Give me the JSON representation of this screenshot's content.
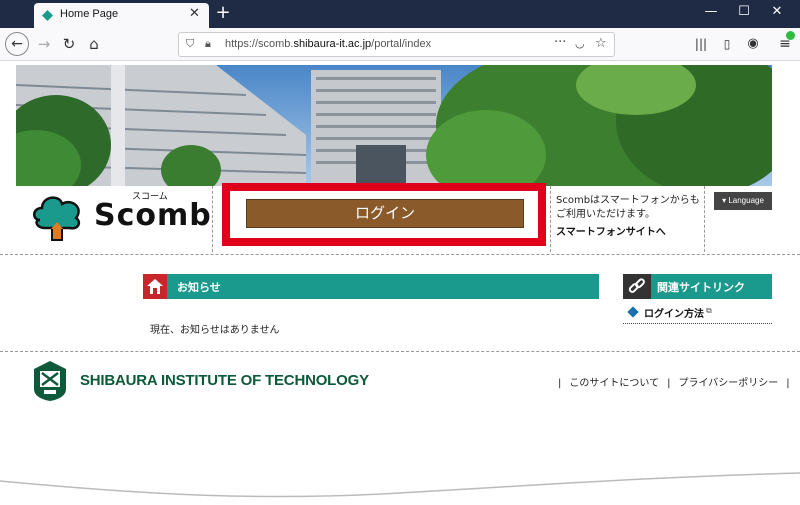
{
  "browser": {
    "tab_title": "Home Page",
    "new_tab_label": "+",
    "url_prefix": "https://scomb.",
    "url_domain": "shibaura-it.ac.jp",
    "url_path": "/portal/index",
    "window_buttons": {
      "minimize": "—",
      "maximize": "☐",
      "close": "✕"
    }
  },
  "header": {
    "logo_text": "Scomb",
    "logo_kana": "スコーム",
    "login_label": "ログイン",
    "smartphone_text": "Scombはスマートフォンからもご利用いただけます。",
    "smartphone_link": "スマートフォンサイトへ",
    "language_label": "▾ Language"
  },
  "news": {
    "title": "お知らせ",
    "empty_message": "現在、お知らせはありません"
  },
  "related": {
    "title": "関連サイトリンク",
    "items": [
      {
        "label": "ログイン方法"
      }
    ]
  },
  "footer": {
    "institute_name": "SHIBAURA INSTITUTE OF TECHNOLOGY",
    "links": [
      "このサイトについて",
      "プライバシーポリシー"
    ],
    "separator": "|"
  },
  "colors": {
    "login_red": "#e0001b",
    "login_brown": "#8a5a2a",
    "teal": "#1a9a8c",
    "news_red": "#c8262b",
    "sit_green": "#0d5a3a"
  }
}
